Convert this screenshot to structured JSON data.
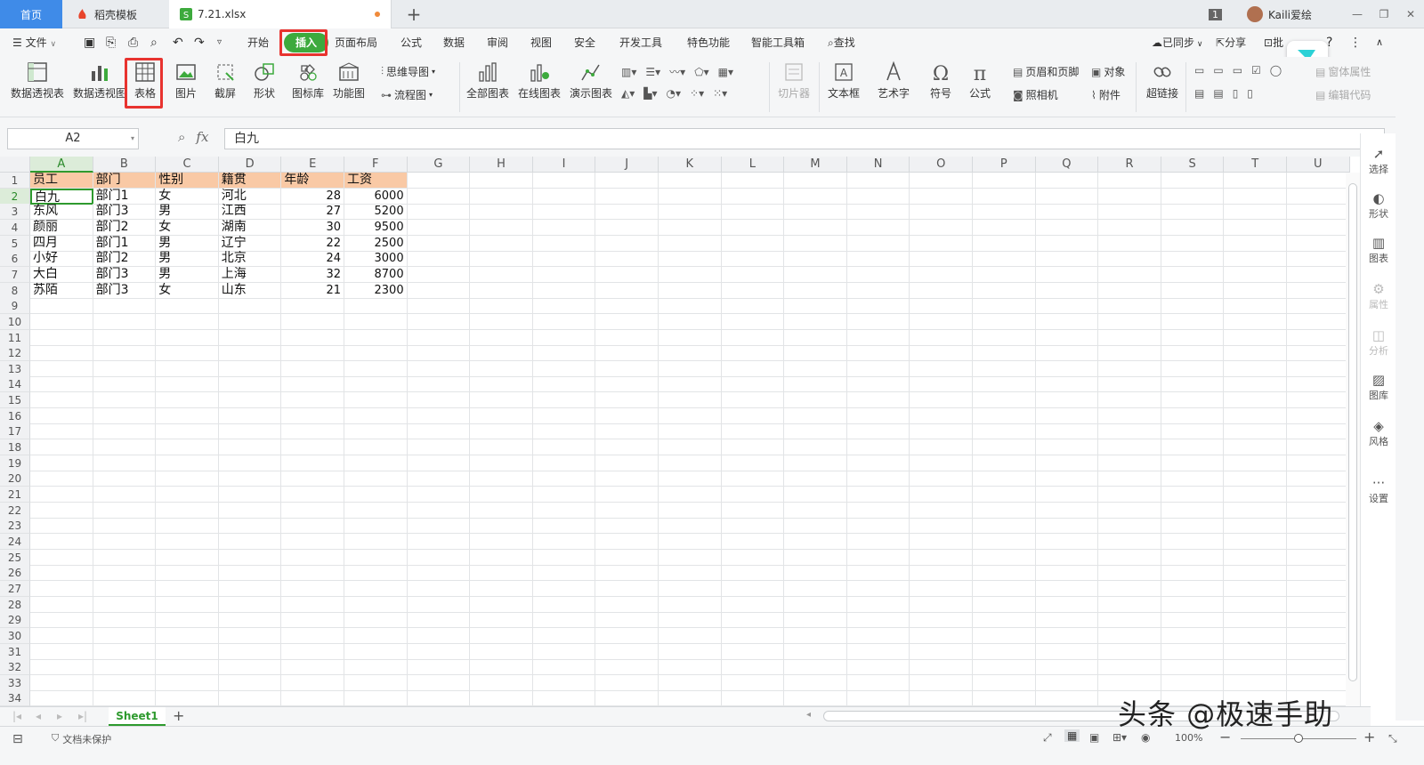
{
  "tabs": {
    "home": "首页",
    "docer": "稻壳模板",
    "file": "7.21.xlsx",
    "new_tab": "+",
    "badge": "1",
    "user": "Kaili爱绘"
  },
  "menu": {
    "file": "文件",
    "items": [
      "开始",
      "插入",
      "页面布局",
      "公式",
      "数据",
      "审阅",
      "视图",
      "安全",
      "开发工具",
      "特色功能",
      "智能工具箱"
    ],
    "search": "查找",
    "sync": "已同步",
    "share": "分享",
    "collab": "批"
  },
  "ribbon": {
    "pivot_table": "数据透视表",
    "pivot_chart": "数据透视图",
    "table": "表格",
    "picture": "图片",
    "screenshot": "截屏",
    "shape": "形状",
    "icon_lib": "图标库",
    "func_chart": "功能图",
    "mindmap": "思维导图",
    "flowchart": "流程图",
    "all_charts": "全部图表",
    "online_chart": "在线图表",
    "demo_chart": "演示图表",
    "slicer": "切片器",
    "textbox": "文本框",
    "wordart": "艺术字",
    "symbol": "符号",
    "formula": "公式",
    "header_footer": "页眉和页脚",
    "object": "对象",
    "camera": "照相机",
    "attachment": "附件",
    "hyperlink": "超链接",
    "form_props": "窗体属性",
    "edit_code": "编辑代码"
  },
  "formula_bar": {
    "name_box": "A2",
    "fx": "fx",
    "value": "白九"
  },
  "sheet": {
    "columns": [
      "A",
      "B",
      "C",
      "D",
      "E",
      "F",
      "G",
      "H",
      "I",
      "J",
      "K",
      "L",
      "M",
      "N",
      "O",
      "P",
      "Q",
      "R",
      "S",
      "T",
      "U"
    ],
    "row_count": 34,
    "header": [
      "员工",
      "部门",
      "性别",
      "籍贯",
      "年龄",
      "工资"
    ],
    "rows": [
      [
        "白九",
        "部门1",
        "女",
        "河北",
        "28",
        "6000"
      ],
      [
        "东风",
        "部门3",
        "男",
        "江西",
        "27",
        "5200"
      ],
      [
        "颜丽",
        "部门2",
        "女",
        "湖南",
        "30",
        "9500"
      ],
      [
        "四月",
        "部门1",
        "男",
        "辽宁",
        "22",
        "2500"
      ],
      [
        "小好",
        "部门2",
        "男",
        "北京",
        "24",
        "3000"
      ],
      [
        "大白",
        "部门3",
        "男",
        "上海",
        "32",
        "8700"
      ],
      [
        "苏陌",
        "部门3",
        "女",
        "山东",
        "21",
        "2300"
      ]
    ],
    "active_cell": "A2",
    "tab": "Sheet1"
  },
  "side_panel": {
    "select": "选择",
    "shape": "形状",
    "chart": "图表",
    "props": "属性",
    "analysis": "分析",
    "gallery": "图库",
    "style": "风格",
    "settings": "设置"
  },
  "status": {
    "protect": "文档未保护",
    "zoom": "100%"
  },
  "watermark": "头条 @极速手助",
  "colors": {
    "accent": "#3daa3d",
    "header_fill": "#f9c9a5",
    "highlight": "#e8332f",
    "tab_home": "#3f8be8"
  }
}
